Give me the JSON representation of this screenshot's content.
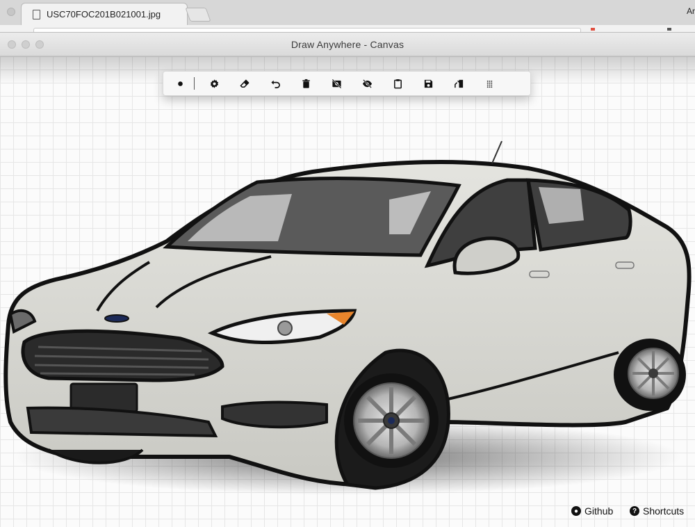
{
  "browser": {
    "tab_title": "USC70FOC201B021001.jpg",
    "tab_close": "✕",
    "profile": "Ar"
  },
  "window": {
    "title": "Draw Anywhere - Canvas"
  },
  "toolbar": {
    "tools": [
      {
        "name": "brush-size-icon",
        "label": "Brush size"
      },
      {
        "name": "settings-icon",
        "label": "Settings"
      },
      {
        "name": "eraser-icon",
        "label": "Eraser"
      },
      {
        "name": "undo-icon",
        "label": "Undo"
      },
      {
        "name": "trash-icon",
        "label": "Clear"
      },
      {
        "name": "hide-background-icon",
        "label": "Hide background"
      },
      {
        "name": "eye-off-icon",
        "label": "Hide drawing"
      },
      {
        "name": "clipboard-icon",
        "label": "Copy"
      },
      {
        "name": "save-icon",
        "label": "Save"
      },
      {
        "name": "resize-icon",
        "label": "Resize"
      },
      {
        "name": "drag-handle-icon",
        "label": "Move"
      }
    ]
  },
  "footer": {
    "github_label": "Github",
    "shortcuts_label": "Shortcuts"
  }
}
